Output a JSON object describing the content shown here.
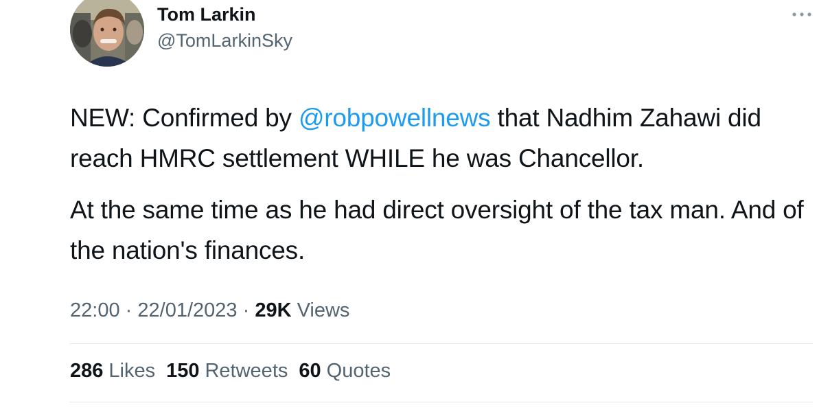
{
  "author": {
    "display_name": "Tom Larkin",
    "handle": "@TomLarkinSky"
  },
  "menu": {
    "icon": "more-horizontal-icon"
  },
  "tweet": {
    "paragraph1": {
      "before_mention": "NEW: Confirmed by ",
      "mention": "@robpowellnews",
      "after_mention": " that Nadhim Zahawi did reach HMRC settlement WHILE he was Chancellor."
    },
    "paragraph2": "At the same time as he had direct oversight of the tax man. And of the nation's finances."
  },
  "meta": {
    "time": "22:00",
    "separator": "·",
    "date": "22/01/2023",
    "views_count": "29K",
    "views_label": "Views"
  },
  "stats": {
    "likes_count": "286",
    "likes_label": "Likes",
    "retweets_count": "150",
    "retweets_label": "Retweets",
    "quotes_count": "60",
    "quotes_label": "Quotes"
  },
  "colors": {
    "link": "#1d9bf0",
    "secondary_text": "#536471",
    "primary_text": "#0f1419",
    "divider": "#e1e5e8"
  }
}
